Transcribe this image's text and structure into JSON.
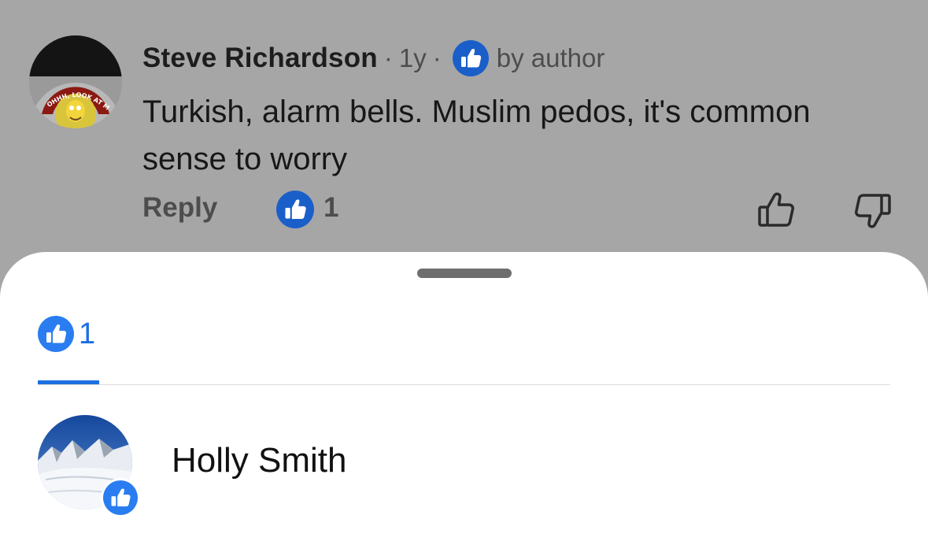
{
  "comment": {
    "author": "Steve Richardson",
    "age": "1y",
    "separator": "·",
    "liked_by_author_label": "by author",
    "text": "Turkish, alarm bells. Muslim pedos, it's common sense to worry",
    "reply_label": "Reply",
    "like_count": "1",
    "avatar_caption": "OHHH, LOOK AT ME!!!"
  },
  "sheet": {
    "tab": {
      "count": "1"
    },
    "reactors": [
      {
        "name": "Holly Smith",
        "reaction": "like"
      }
    ]
  },
  "colors": {
    "like_blue": "#1a6fe8",
    "accent": "#1c6fe0",
    "dim_background": "#a6a6a6"
  },
  "icons": {
    "reaction": "thumbs-up-icon",
    "like_action": "thumbs-up-outline-icon",
    "dislike_action": "thumbs-down-outline-icon"
  }
}
